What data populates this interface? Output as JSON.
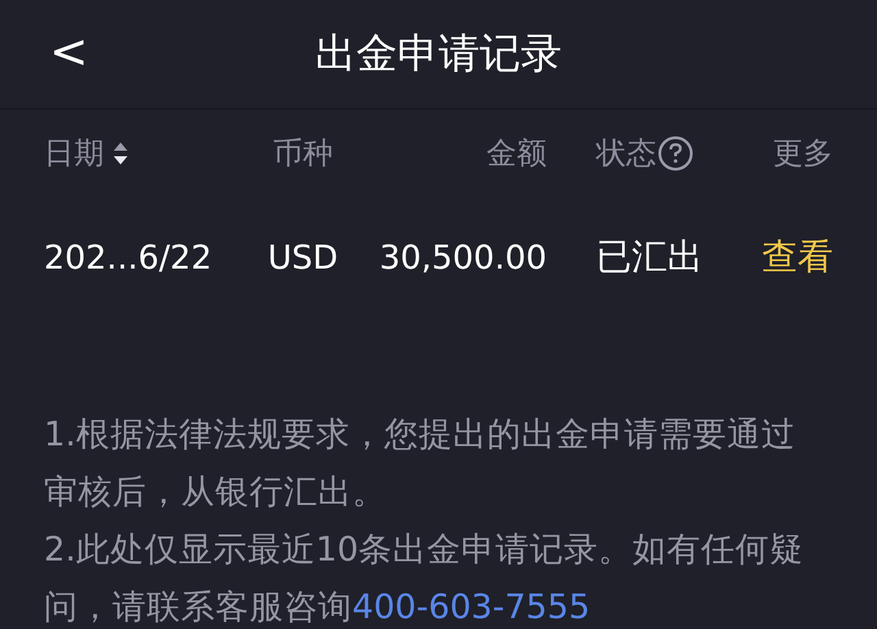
{
  "header": {
    "back": "<",
    "title": "出金申请记录"
  },
  "table": {
    "columns": [
      {
        "label": "日期",
        "sortable": true,
        "help": false
      },
      {
        "label": "币种",
        "sortable": false,
        "help": false
      },
      {
        "label": "金额",
        "sortable": false,
        "help": false
      },
      {
        "label": "状态",
        "sortable": false,
        "help": true
      },
      {
        "label": "更多",
        "sortable": false,
        "help": false
      }
    ],
    "rows": [
      {
        "date": "202...6/22",
        "currency": "USD",
        "amount": "30,500.00",
        "status": "已汇出",
        "action": "查看"
      }
    ]
  },
  "notes": [
    {
      "text": "1.根据法律法规要求，您提出的出金申请需要通过审核后，从银行汇出。"
    },
    {
      "text": "2.此处仅显示最近10条出金申请记录。如有任何疑问，请联系客服咨询",
      "phone": "400-603-7555"
    }
  ]
}
